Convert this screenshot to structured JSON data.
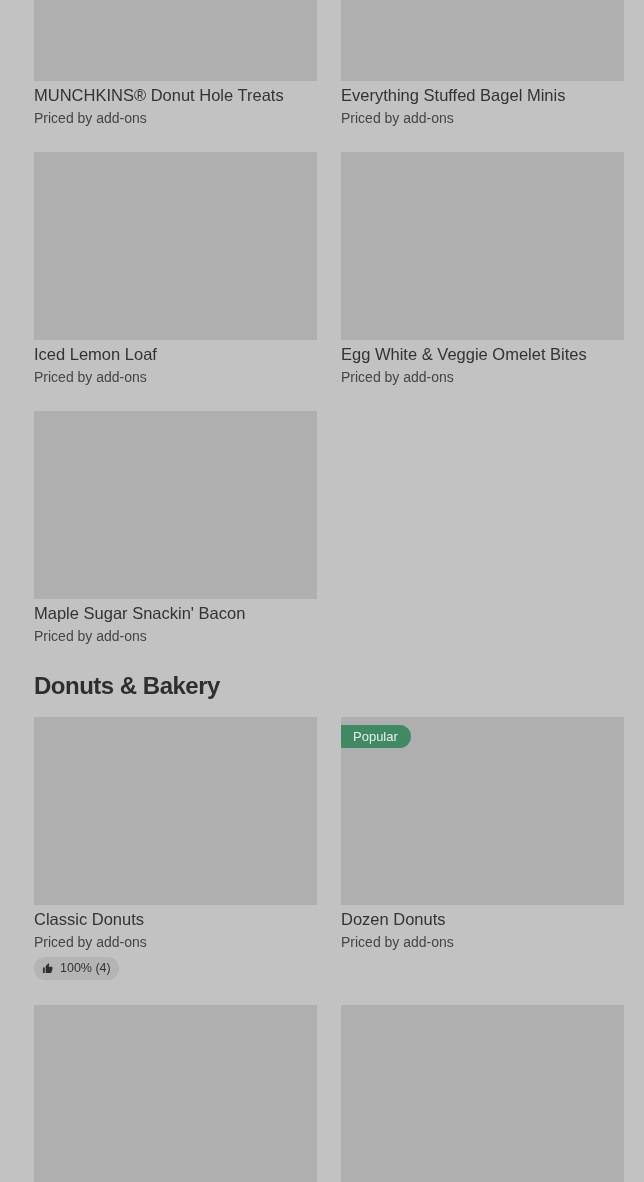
{
  "sections": [
    {
      "items": [
        {
          "kind": "product",
          "title": "MUNCHKINS® Donut Hole Treats",
          "subtitle": "Priced by add-ons"
        },
        {
          "kind": "product",
          "title": "Everything Stuffed Bagel Minis",
          "subtitle": "Priced by add-ons"
        },
        {
          "kind": "product",
          "title": "Iced Lemon Loaf",
          "subtitle": "Priced by add-ons"
        },
        {
          "kind": "product",
          "title": "Egg White & Veggie Omelet Bites",
          "subtitle": "Priced by add-ons"
        },
        {
          "kind": "product",
          "title": "Maple Sugar Snackin' Bacon",
          "subtitle": "Priced by add-ons"
        }
      ]
    },
    {
      "title": "Donuts & Bakery",
      "items": [
        {
          "kind": "product",
          "title": "Classic Donuts",
          "subtitle": "Priced by add-ons",
          "rating": "100% (4)"
        },
        {
          "kind": "product",
          "title": "Dozen Donuts",
          "subtitle": "Priced by add-ons",
          "badge": "Popular"
        },
        {
          "kind": "picture"
        },
        {
          "kind": "picture"
        }
      ]
    }
  ]
}
